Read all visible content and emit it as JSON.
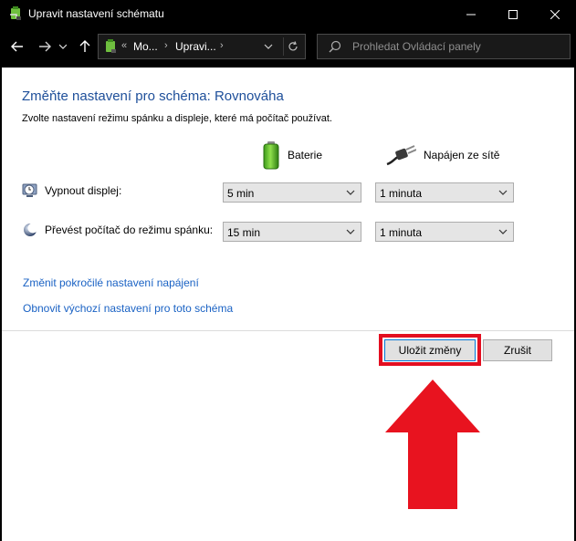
{
  "window": {
    "title": "Upravit nastavení schématu"
  },
  "address": {
    "breadcrumbs": [
      "Mo...",
      "Upravi..."
    ],
    "overflow": "«"
  },
  "search": {
    "placeholder": "Prohledat Ovládací panely"
  },
  "page": {
    "heading": "Změňte nastavení pro schéma: Rovnováha",
    "subheading": "Zvolte nastavení režimu spánku a displeje, které má počítač používat."
  },
  "columns": {
    "battery": "Baterie",
    "plugged": "Napájen ze sítě"
  },
  "rows": [
    {
      "label": "Vypnout displej:",
      "battery": "5 min",
      "plugged": "1 minuta"
    },
    {
      "label": "Převést počítač do režimu spánku:",
      "battery": "15 min",
      "plugged": "1 minuta"
    }
  ],
  "links": {
    "advanced": "Změnit pokročilé nastavení napájení",
    "restore": "Obnovit výchozí nastavení pro toto schéma"
  },
  "buttons": {
    "save": "Uložit změny",
    "cancel": "Zrušit"
  },
  "colors": {
    "accent_link": "#1a62c4",
    "heading": "#1e4f9a",
    "annotation_red": "#e30e20"
  }
}
